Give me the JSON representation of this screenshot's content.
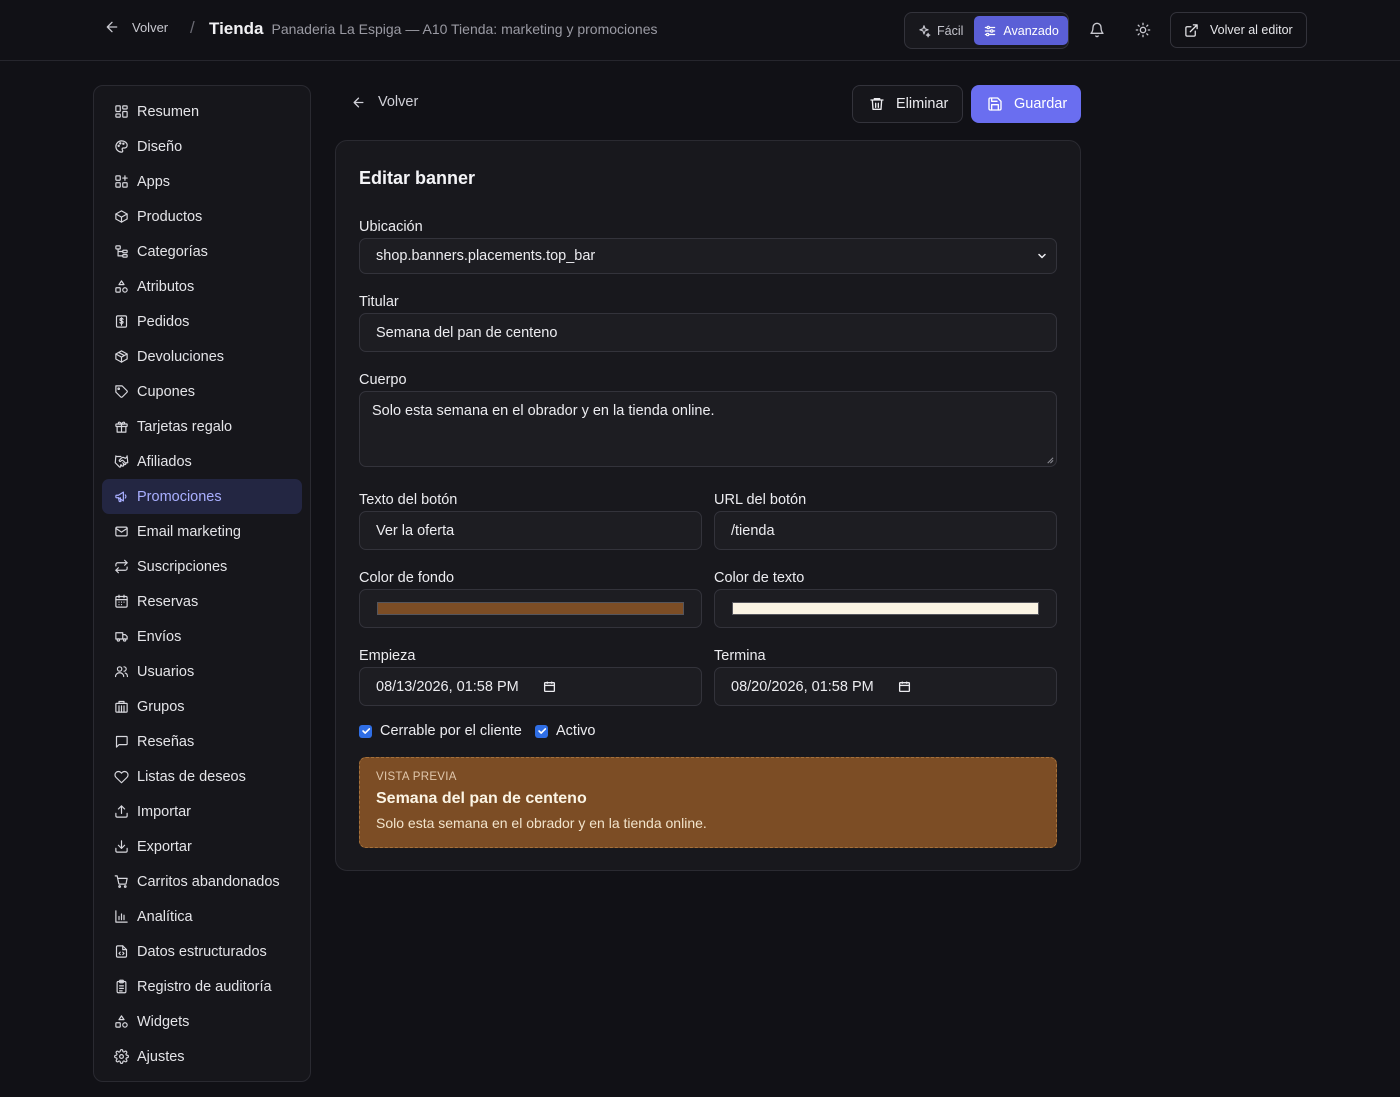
{
  "topbar": {
    "back_label": "Volver",
    "separator": "/",
    "title": "Tienda",
    "subtitle": "Panaderia La Espiga — A10 Tienda: marketing y promociones",
    "mode_easy": "Fácil",
    "mode_advanced": "Avanzado",
    "editor_label": "Volver al editor"
  },
  "sidebar": {
    "items": [
      {
        "label": "Resumen",
        "icon": "dashboard-icon"
      },
      {
        "label": "Diseño",
        "icon": "palette-icon"
      },
      {
        "label": "Apps",
        "icon": "apps-icon"
      },
      {
        "label": "Productos",
        "icon": "box-icon"
      },
      {
        "label": "Categorías",
        "icon": "tree-icon"
      },
      {
        "label": "Atributos",
        "icon": "shapes-icon"
      },
      {
        "label": "Pedidos",
        "icon": "receipt-icon"
      },
      {
        "label": "Devoluciones",
        "icon": "package-return-icon"
      },
      {
        "label": "Cupones",
        "icon": "tag-icon"
      },
      {
        "label": "Tarjetas regalo",
        "icon": "gift-icon"
      },
      {
        "label": "Afiliados",
        "icon": "handshake-icon"
      },
      {
        "label": "Promociones",
        "icon": "megaphone-icon"
      },
      {
        "label": "Email marketing",
        "icon": "mail-icon"
      },
      {
        "label": "Suscripciones",
        "icon": "repeat-icon"
      },
      {
        "label": "Reservas",
        "icon": "calendar-icon"
      },
      {
        "label": "Envíos",
        "icon": "truck-icon"
      },
      {
        "label": "Usuarios",
        "icon": "users-icon"
      },
      {
        "label": "Grupos",
        "icon": "building-icon"
      },
      {
        "label": "Reseñas",
        "icon": "message-icon"
      },
      {
        "label": "Listas de deseos",
        "icon": "heart-icon"
      },
      {
        "label": "Importar",
        "icon": "upload-icon"
      },
      {
        "label": "Exportar",
        "icon": "download-icon"
      },
      {
        "label": "Carritos abandonados",
        "icon": "cart-icon"
      },
      {
        "label": "Analítica",
        "icon": "bar-chart-icon"
      },
      {
        "label": "Datos estructurados",
        "icon": "file-code-icon"
      },
      {
        "label": "Registro de auditoría",
        "icon": "clipboard-icon"
      },
      {
        "label": "Widgets",
        "icon": "widgets-icon"
      },
      {
        "label": "Ajustes",
        "icon": "gear-icon"
      }
    ],
    "active_index": 11
  },
  "toolbar": {
    "back_label": "Volver",
    "delete_label": "Eliminar",
    "save_label": "Guardar"
  },
  "form": {
    "title": "Editar banner",
    "placement_label": "Ubicación",
    "placement_value": "shop.banners.placements.top_bar",
    "headline_label": "Titular",
    "headline_value": "Semana del pan de centeno",
    "body_label": "Cuerpo",
    "body_value": "Solo esta semana en el obrador y en la tienda online.",
    "button_text_label": "Texto del botón",
    "button_text_value": "Ver la oferta",
    "button_url_label": "URL del botón",
    "button_url_value": "/tienda",
    "bg_color_label": "Color de fondo",
    "bg_color_value": "#7c4d25",
    "text_color_label": "Color de texto",
    "text_color_value": "#fbf4e4",
    "starts_label": "Empieza",
    "starts_value": "08/13/2026, 01:58 PM",
    "ends_label": "Termina",
    "ends_value": "08/20/2026, 01:58 PM",
    "dismissible_label": "Cerrable por el cliente",
    "dismissible_checked": true,
    "active_label": "Activo",
    "active_checked": true
  },
  "preview": {
    "tag": "VISTA PREVIA",
    "title": "Semana del pan de centeno",
    "body": "Solo esta semana en el obrador y en la tienda online."
  }
}
